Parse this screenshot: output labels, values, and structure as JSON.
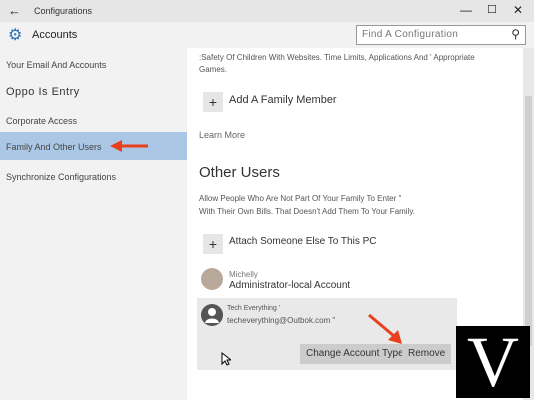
{
  "window": {
    "title": "Configurations",
    "back_icon": "arrow-left-icon",
    "controls": [
      "minimize-icon",
      "maximize-icon",
      "close-icon"
    ]
  },
  "sidebar": {
    "header_label": "Accounts",
    "items": [
      {
        "label": "Your Email And Accounts",
        "active": false
      },
      {
        "label": "Oppo Is Entry",
        "active": false
      },
      {
        "label": "Corporate Access",
        "active": false
      },
      {
        "label": "Family And Other Users",
        "active": true
      },
      {
        "label": "Synchronize Configurations",
        "active": false
      }
    ]
  },
  "search": {
    "placeholder": "Find A Configuration",
    "icon": "search-icon"
  },
  "main": {
    "family_note": ":Safety Of Children With Websites. Time Limits, Applications And ' Appropriate Games.",
    "add_family_member": "Add A Family Member",
    "learn_more": "Learn More",
    "other_users_heading": "Other Users",
    "other_users_desc_1": "Allow People Who Are Not Part Of Your Family To Enter \"",
    "other_users_desc_2": "With Their Own Bills. That Doesn't Add Them To Your Family.",
    "add_someone": "Attach Someone Else To This PC",
    "users": [
      {
        "name": "Michelly",
        "role": "Administrator-local Account"
      },
      {
        "name": "Tech Everything '",
        "email": "techeverything@Outbok.com \""
      }
    ],
    "change_account_type": "Change Account Type",
    "remove": "Remove"
  },
  "colors": {
    "accent": "#2f6fb6",
    "active_nav": "#aac8e6",
    "arrow": "#e8401c"
  },
  "watermark": "V"
}
